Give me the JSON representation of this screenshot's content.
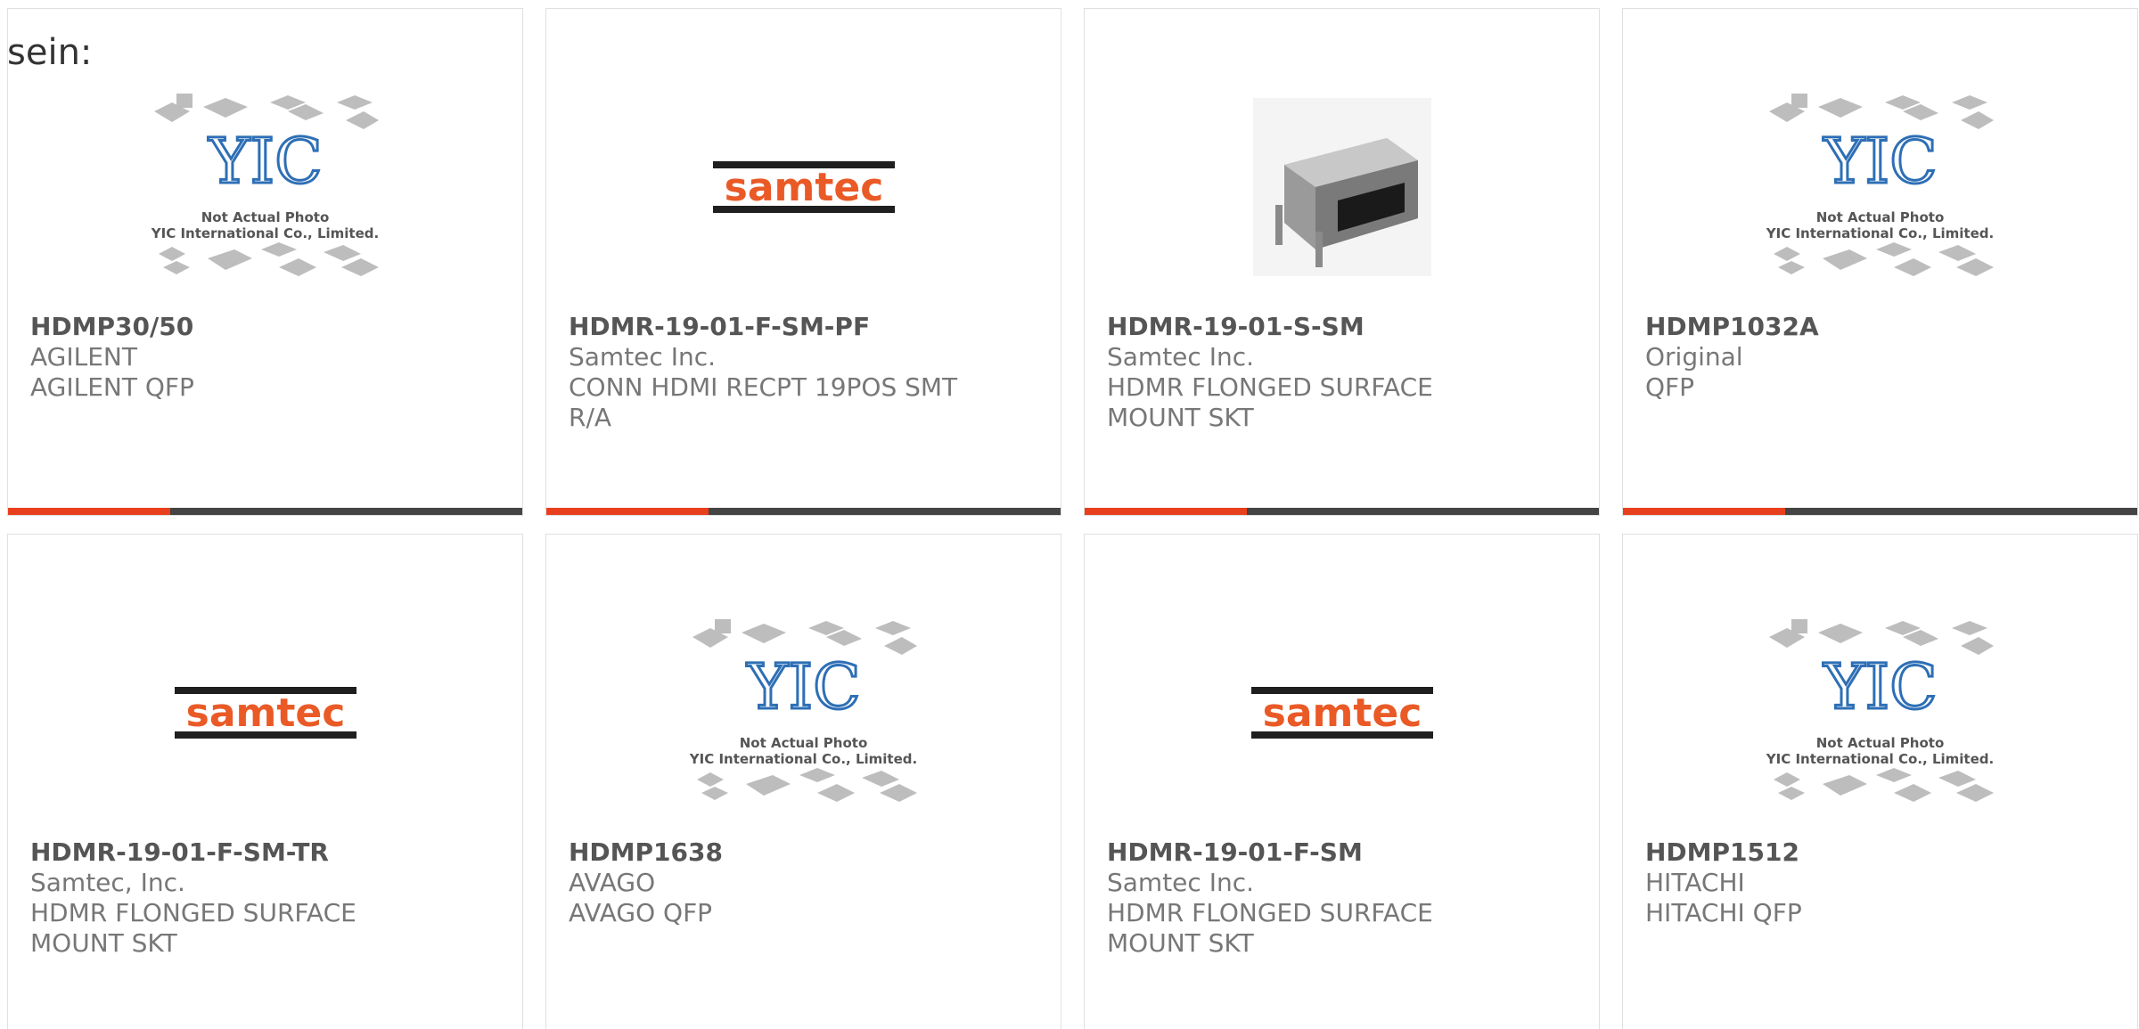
{
  "heading": "sein:",
  "placeholder": {
    "line1": "Not Actual Photo",
    "line2": "YIC International Co., Limited.",
    "logo": "YIC"
  },
  "brand": {
    "samtec_text": "samtec",
    "samtec_color": "#ea5a26",
    "bar_color": "#1f1f1f",
    "accent_color": "#e8401c",
    "bar_dark": "#444444"
  },
  "products": [
    {
      "part": "HDMP30/50",
      "manufacturer": "AGILENT",
      "description": "AGILENT QFP",
      "image": "yic-placeholder"
    },
    {
      "part": "HDMR-19-01-F-SM-PF",
      "manufacturer": "Samtec Inc.",
      "description_line1": "CONN HDMI RECPT 19POS SMT",
      "description_line2": "R/A",
      "image": "samtec-logo"
    },
    {
      "part": "HDMR-19-01-S-SM",
      "manufacturer": "Samtec Inc.",
      "description_line1": "HDMR FLONGED SURFACE",
      "description_line2": "MOUNT SKT",
      "image": "hdmi-connector-photo"
    },
    {
      "part": "HDMP1032A",
      "manufacturer": "Original",
      "description": "QFP",
      "image": "yic-placeholder"
    },
    {
      "part": "HDMR-19-01-F-SM-TR",
      "manufacturer": "Samtec, Inc.",
      "description_line1": "HDMR FLONGED SURFACE",
      "description_line2": "MOUNT SKT",
      "image": "samtec-logo"
    },
    {
      "part": "HDMP1638",
      "manufacturer": "AVAGO",
      "description": "AVAGO QFP",
      "image": "yic-placeholder"
    },
    {
      "part": "HDMR-19-01-F-SM",
      "manufacturer": "Samtec Inc.",
      "description_line1": "HDMR FLONGED SURFACE",
      "description_line2": "MOUNT SKT",
      "image": "samtec-logo"
    },
    {
      "part": "HDMP1512",
      "manufacturer": "HITACHI",
      "description": "HITACHI QFP",
      "image": "yic-placeholder"
    }
  ]
}
